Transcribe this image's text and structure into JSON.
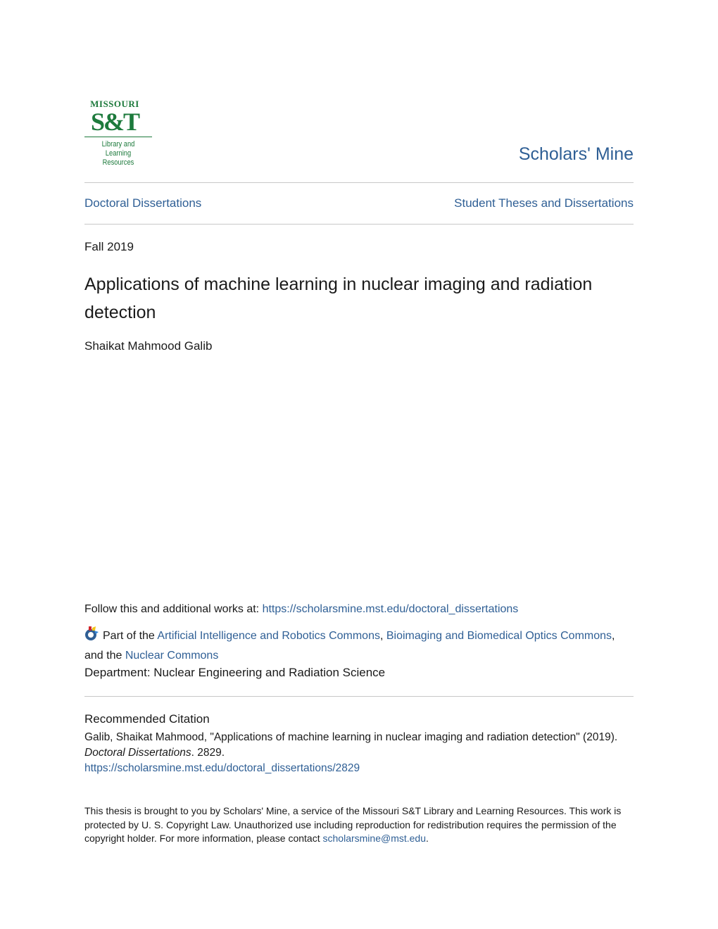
{
  "logo": {
    "line1": "MISSOURI",
    "line2": "S&T",
    "line3": "Library and",
    "line4": "Learning Resources",
    "color": "#1d7a3c"
  },
  "brand": "Scholars' Mine",
  "breadcrumbs": {
    "left": "Doctoral Dissertations",
    "right": "Student Theses and Dissertations"
  },
  "date": "Fall 2019",
  "title": "Applications of machine learning in nuclear imaging and radiation detection",
  "author": "Shaikat Mahmood Galib",
  "follow": {
    "label": "Follow this and additional works at: ",
    "url": "https://scholarsmine.mst.edu/doctoral_dissertations"
  },
  "part_of": {
    "prefix": "Part of the ",
    "link1": "Artificial Intelligence and Robotics Commons",
    "sep1": ", ",
    "link2": "Bioimaging and Biomedical Optics Commons",
    "sep2": ", and the ",
    "link3": "Nuclear Commons"
  },
  "department": "Department: Nuclear Engineering and Radiation Science",
  "citation": {
    "heading": "Recommended Citation",
    "text1": "Galib, Shaikat Mahmood, \"Applications of machine learning in nuclear imaging and radiation detection\" (2019). ",
    "series": "Doctoral Dissertations",
    "text2": ". 2829.",
    "url": "https://scholarsmine.mst.edu/doctoral_dissertations/2829"
  },
  "notice": {
    "text": "This thesis is brought to you by Scholars' Mine, a service of the Missouri S&T Library and Learning Resources. This work is protected by U. S. Copyright Law. Unauthorized use including reproduction for redistribution requires the permission of the copyright holder. For more information, please contact ",
    "email": "scholarsmine@mst.edu",
    "end": "."
  },
  "colors": {
    "link": "#2f5f95",
    "text": "#1a1a1a",
    "rule": "#c8c8c8"
  }
}
